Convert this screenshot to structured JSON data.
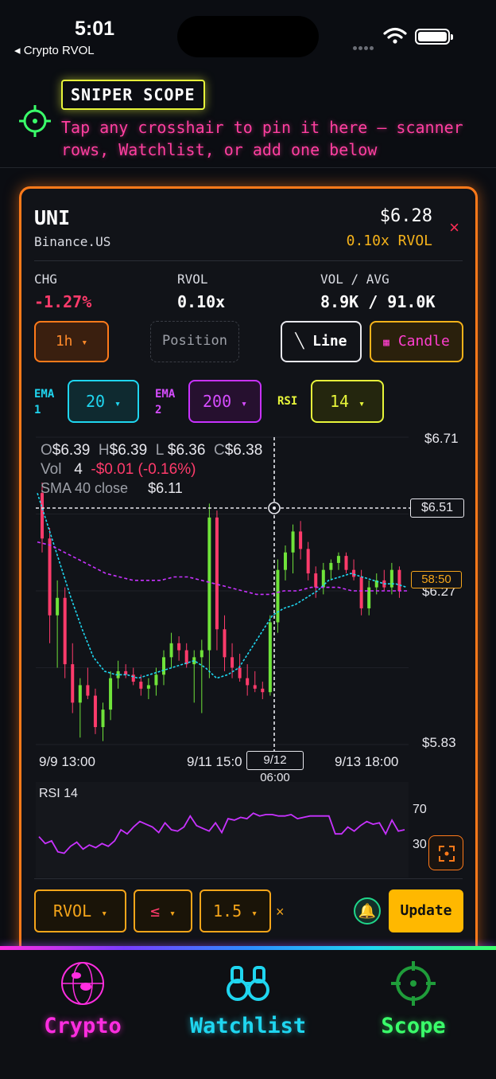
{
  "status": {
    "time": "5:01",
    "back_label": "◂ Crypto RVOL"
  },
  "scope": {
    "badge": "SNIPER SCOPE",
    "hint": "Tap any crosshair to pin it here — scanner rows, Watchlist, or add one below"
  },
  "card": {
    "symbol": "UNI",
    "exchange": "Binance.US",
    "price": "$6.28",
    "rvol_multiple": "0.10x RVOL",
    "close_label": "×",
    "stats": [
      {
        "label": "CHG",
        "value": "-1.27%"
      },
      {
        "label": "RVOL",
        "value": "0.10x"
      },
      {
        "label": "VOL / AVG",
        "value": "8.9K / 91.0K"
      }
    ],
    "timeframe": "1h",
    "position_label": "Position",
    "line_label": "Line",
    "candle_label": "Candle",
    "ema1_label": "EMA 1",
    "ema1_value": "20",
    "ema2_label": "EMA 2",
    "ema2_value": "200",
    "rsi_label": "RSI",
    "rsi_value": "14",
    "caret": "▾",
    "legend": {
      "o": "$6.39",
      "h": "$6.39",
      "l": "$6.36",
      "c": "$6.38",
      "vol_label": "Vol",
      "vol": "4",
      "vol_change": "-$0.01 (-0.16%)",
      "sma_label": "SMA 40 close",
      "sma_value": "$6.11"
    },
    "rsi_pane": {
      "title": "RSI 14",
      "upper": "70",
      "lower": "30"
    },
    "alert": {
      "field": "RVOL",
      "op": "≤",
      "value": "1.5",
      "clear": "×",
      "update_label": "Update"
    }
  },
  "chart_data": {
    "type": "candlestick",
    "x_ticks": [
      "9/9 13:00",
      "9/11 15:0",
      "9/13 18:00"
    ],
    "crosshair_x_label": "9/12 06:00",
    "crosshair_y_label": "$6.51",
    "last_price_label": "$6.27",
    "countdown_label": "58:50",
    "y_top_label": "$6.71",
    "y_bottom_label": "$5.83",
    "ylim": [
      5.83,
      6.71
    ],
    "candles": [
      [
        6.55,
        6.58,
        6.38,
        6.42
      ],
      [
        6.42,
        6.45,
        6.12,
        6.2
      ],
      [
        6.2,
        6.3,
        6.05,
        6.25
      ],
      [
        6.25,
        6.28,
        6.02,
        6.06
      ],
      [
        6.06,
        6.12,
        5.92,
        5.95
      ],
      [
        5.95,
        6.02,
        5.85,
        6.0
      ],
      [
        6.0,
        6.05,
        5.96,
        5.97
      ],
      [
        5.97,
        5.99,
        5.86,
        5.88
      ],
      [
        5.88,
        5.95,
        5.84,
        5.93
      ],
      [
        5.93,
        6.04,
        5.9,
        6.02
      ],
      [
        6.02,
        6.07,
        5.99,
        6.04
      ],
      [
        6.04,
        6.06,
        6.02,
        6.03
      ],
      [
        6.03,
        6.05,
        6.0,
        6.01
      ],
      [
        6.01,
        6.03,
        5.97,
        5.99
      ],
      [
        5.99,
        6.02,
        5.96,
        6.0
      ],
      [
        6.0,
        6.05,
        5.97,
        6.03
      ],
      [
        6.03,
        6.1,
        6.0,
        6.08
      ],
      [
        6.08,
        6.15,
        6.05,
        6.12
      ],
      [
        6.12,
        6.14,
        6.07,
        6.1
      ],
      [
        6.1,
        6.12,
        6.05,
        6.06
      ],
      [
        6.06,
        6.1,
        5.95,
        6.08
      ],
      [
        6.08,
        6.13,
        5.92,
        6.1
      ],
      [
        6.1,
        6.52,
        6.02,
        6.48
      ],
      [
        6.48,
        6.5,
        6.1,
        6.16
      ],
      [
        6.16,
        6.2,
        6.04,
        6.08
      ],
      [
        6.08,
        6.12,
        6.02,
        6.05
      ],
      [
        6.05,
        6.09,
        6.01,
        6.02
      ],
      [
        6.02,
        6.06,
        5.97,
        6.0
      ],
      [
        6.0,
        6.04,
        5.98,
        5.99
      ],
      [
        5.99,
        6.01,
        5.96,
        5.98
      ],
      [
        5.98,
        6.2,
        5.97,
        6.18
      ],
      [
        6.18,
        6.36,
        6.15,
        6.33
      ],
      [
        6.33,
        6.4,
        6.3,
        6.38
      ],
      [
        6.38,
        6.46,
        6.32,
        6.44
      ],
      [
        6.44,
        6.47,
        6.36,
        6.39
      ],
      [
        6.39,
        6.41,
        6.3,
        6.32
      ],
      [
        6.32,
        6.34,
        6.25,
        6.28
      ],
      [
        6.28,
        6.35,
        6.26,
        6.33
      ],
      [
        6.33,
        6.36,
        6.3,
        6.35
      ],
      [
        6.35,
        6.38,
        6.33,
        6.37
      ],
      [
        6.37,
        6.38,
        6.32,
        6.33
      ],
      [
        6.33,
        6.36,
        6.3,
        6.31
      ],
      [
        6.31,
        6.33,
        6.2,
        6.22
      ],
      [
        6.22,
        6.3,
        6.2,
        6.28
      ],
      [
        6.28,
        6.32,
        6.26,
        6.3
      ],
      [
        6.3,
        6.33,
        6.27,
        6.28
      ],
      [
        6.28,
        6.35,
        6.26,
        6.33
      ],
      [
        6.33,
        6.34,
        6.25,
        6.27
      ]
    ],
    "ema20": [
      6.55,
      6.45,
      6.35,
      6.25,
      6.16,
      6.08,
      6.04,
      6.03,
      6.03,
      6.02,
      6.03,
      6.04,
      6.05,
      6.06,
      6.07,
      6.05,
      6.02,
      6.03,
      6.05,
      6.1,
      6.15,
      6.2,
      6.22,
      6.23,
      6.25,
      6.27,
      6.3,
      6.31,
      6.32,
      6.31,
      6.3,
      6.29,
      6.29,
      6.28
    ],
    "sma40": [
      6.41,
      6.4,
      6.38,
      6.36,
      6.34,
      6.32,
      6.31,
      6.3,
      6.3,
      6.3,
      6.31,
      6.31,
      6.3,
      6.29,
      6.28,
      6.27,
      6.26,
      6.26,
      6.27,
      6.27,
      6.28,
      6.28,
      6.28,
      6.27,
      6.27,
      6.27,
      6.27,
      6.27
    ],
    "rsi": [
      45,
      40,
      42,
      34,
      33,
      38,
      41,
      36,
      39,
      37,
      40,
      38,
      42,
      50,
      47,
      52,
      56,
      54,
      52,
      48,
      55,
      50,
      49,
      52,
      60,
      53,
      51,
      49,
      55,
      48,
      58,
      57,
      59,
      58,
      62,
      60,
      61,
      61,
      60,
      60,
      61,
      58,
      59,
      60,
      60,
      60,
      60,
      47,
      47,
      52,
      49,
      53,
      56,
      54,
      55,
      47,
      57,
      49,
      50
    ]
  },
  "tabs": [
    {
      "label": "Crypto",
      "color": "#ff2de0"
    },
    {
      "label": "Watchlist",
      "color": "#1fd6f0"
    },
    {
      "label": "Scope",
      "color": "#3aff6a"
    }
  ]
}
